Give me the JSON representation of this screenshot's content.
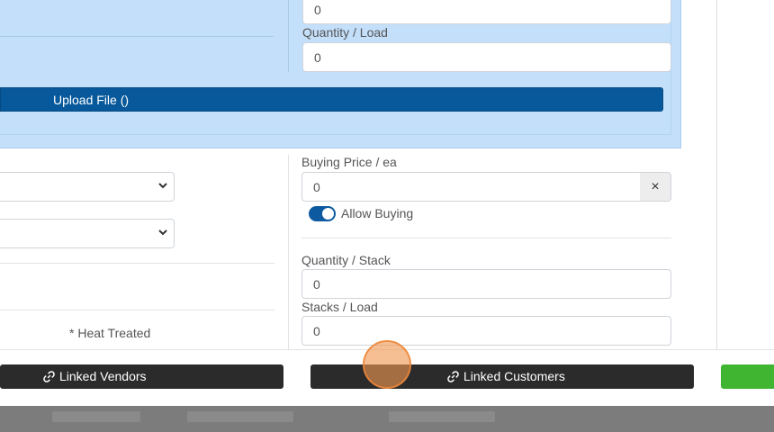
{
  "top_fields": {
    "first_value": "0",
    "quantity_load_label": "Quantity / Load",
    "quantity_load_value": "0"
  },
  "upload": {
    "label": "Upload File ()"
  },
  "pricing": {
    "buying_price_label": "Buying Price / ea",
    "buying_price_value": "0",
    "clear_symbol": "×",
    "allow_buying_label": "Allow Buying",
    "quantity_stack_label": "Quantity / Stack",
    "quantity_stack_value": "0",
    "stacks_load_label": "Stacks / Load",
    "stacks_load_value": "0"
  },
  "left_fields": {
    "heat_treated_label": "* Heat Treated"
  },
  "footer": {
    "linked_vendors_label": "Linked Vendors",
    "linked_customers_label": "Linked Customers"
  },
  "icons": {
    "link": "link-icon",
    "chevron": "chevron-down-icon",
    "clear": "close-icon"
  },
  "colors": {
    "panel_blue": "#c4dffa",
    "upload_blue": "#07599b",
    "dark_button": "#2b2b2b",
    "green_button": "#3fb532",
    "toggle_blue": "#0d5aa0"
  }
}
